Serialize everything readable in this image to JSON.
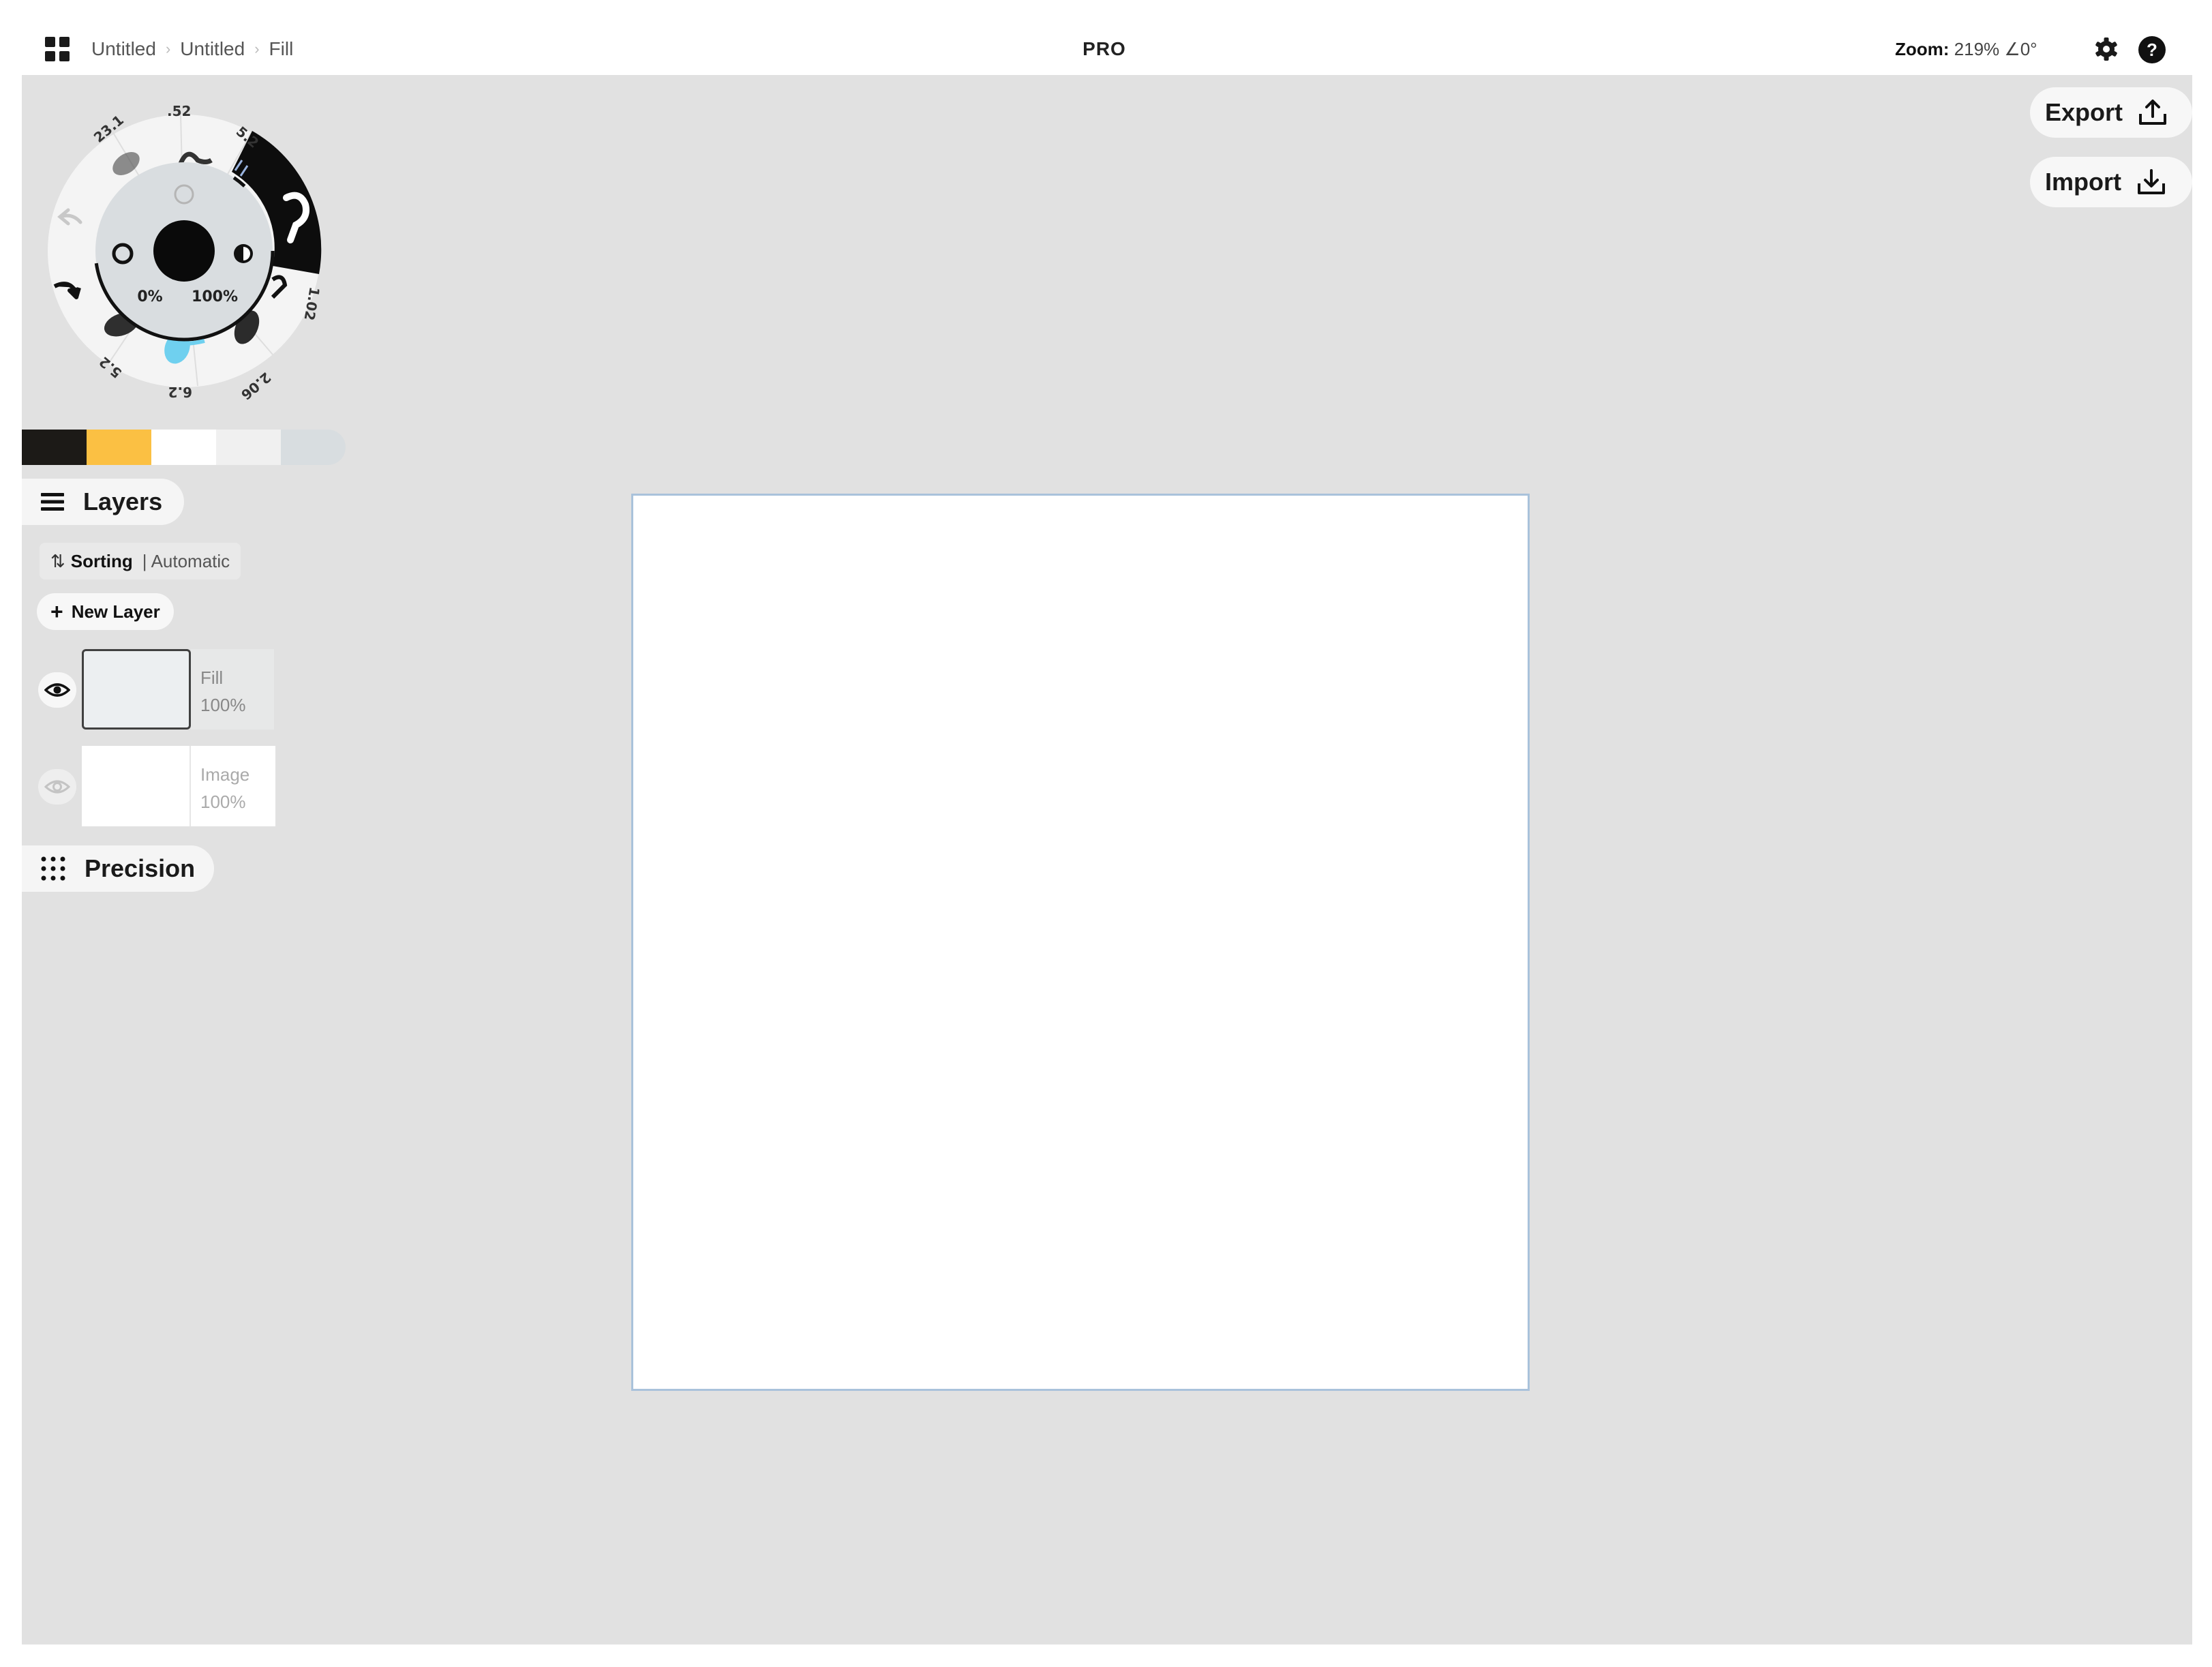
{
  "topbar": {
    "breadcrumb": [
      "Untitled",
      "Untitled",
      "Fill"
    ],
    "title": "PRO",
    "zoom_label": "Zoom:",
    "zoom_value": "219%",
    "rotation_value": "∠0°"
  },
  "actions": {
    "export_label": "Export",
    "import_label": "Import"
  },
  "tool_wheel": {
    "size_labels": [
      "23.1",
      ".52",
      "5.2",
      "1.02",
      "2.06",
      "6.2",
      "5.2"
    ],
    "opacity_label": "0%",
    "smoothing_label": "100%",
    "active_color": "#0a0a0a"
  },
  "colors": {
    "swatches": [
      "#1c1a17",
      "#fbc043",
      "#ffffff",
      "#f0f0f0",
      "#d8dde0"
    ],
    "canvas_border": "#a9c2db",
    "workspace_bg": "#e1e1e1"
  },
  "layers": {
    "header_label": "Layers",
    "sorting_label": "Sorting",
    "sorting_mode": "Automatic",
    "new_layer_label": "New Layer",
    "items": [
      {
        "name": "Fill",
        "opacity": "100%",
        "visible": true
      },
      {
        "name": "Image",
        "opacity": "100%",
        "visible": false
      }
    ]
  },
  "precision": {
    "header_label": "Precision"
  }
}
